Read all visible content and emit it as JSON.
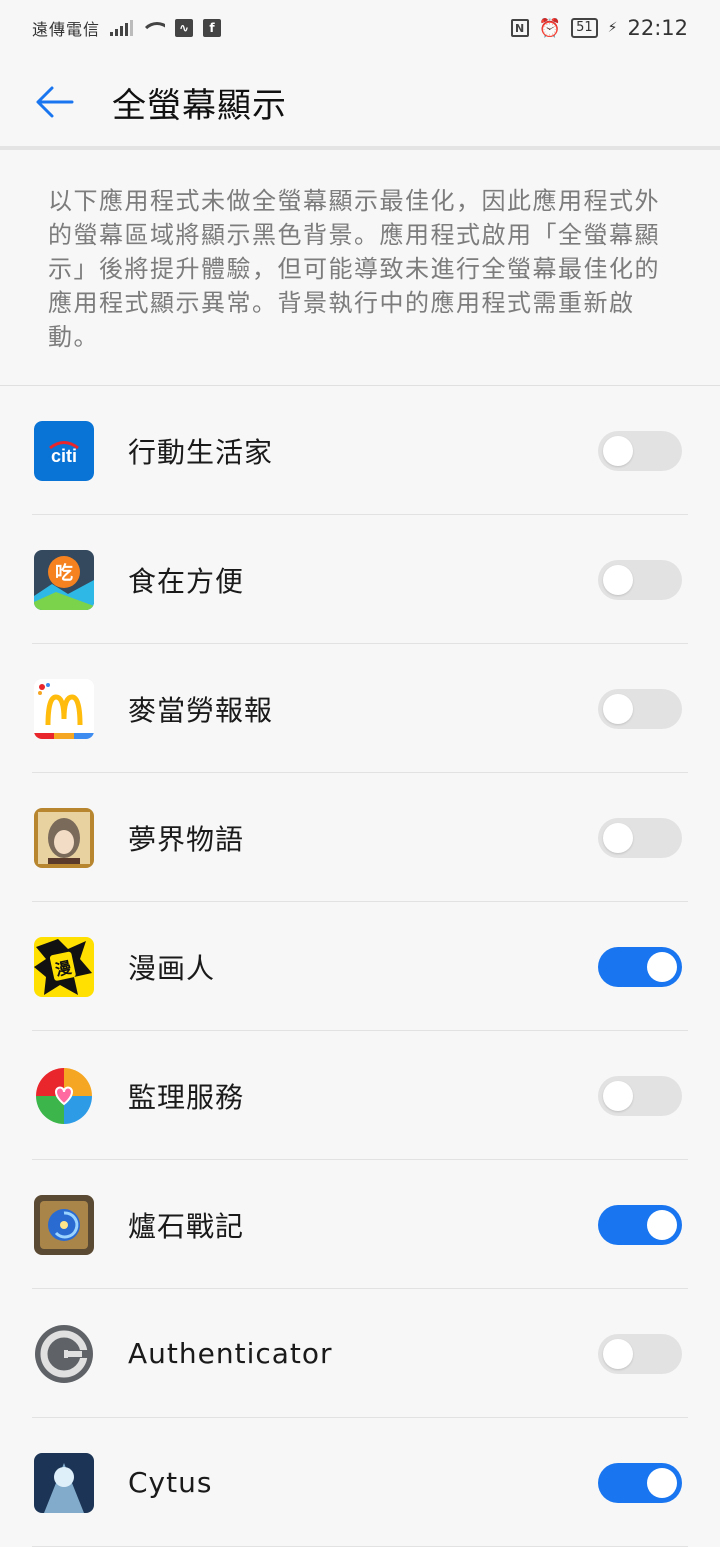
{
  "status_bar": {
    "carrier": "遠傳電信",
    "battery": "51",
    "time": "22:12"
  },
  "header": {
    "title": "全螢幕顯示"
  },
  "description": "以下應用程式未做全螢幕顯示最佳化，因此應用程式外的螢幕區域將顯示黑色背景。應用程式啟用「全螢幕顯示」後將提升體驗，但可能導致未進行全螢幕最佳化的應用程式顯示異常。背景執行中的應用程式需重新啟動。",
  "apps": [
    {
      "name": "行動生活家",
      "enabled": false,
      "icon": "citi-icon"
    },
    {
      "name": "食在方便",
      "enabled": false,
      "icon": "food-delivery-icon"
    },
    {
      "name": "麥當勞報報",
      "enabled": false,
      "icon": "mcdonalds-icon"
    },
    {
      "name": "夢界物語",
      "enabled": false,
      "icon": "dream-realm-icon"
    },
    {
      "name": "漫画人",
      "enabled": true,
      "icon": "manhuaren-icon"
    },
    {
      "name": "監理服務",
      "enabled": false,
      "icon": "dmv-service-icon"
    },
    {
      "name": "爐石戰記",
      "enabled": true,
      "icon": "hearthstone-icon"
    },
    {
      "name": "Authenticator",
      "enabled": false,
      "icon": "authenticator-icon"
    },
    {
      "name": "Cytus",
      "enabled": true,
      "icon": "cytus-icon"
    }
  ],
  "colors": {
    "accent": "#1976f0",
    "toggle_off": "#e2e2e2",
    "background": "#f7f7f7"
  }
}
